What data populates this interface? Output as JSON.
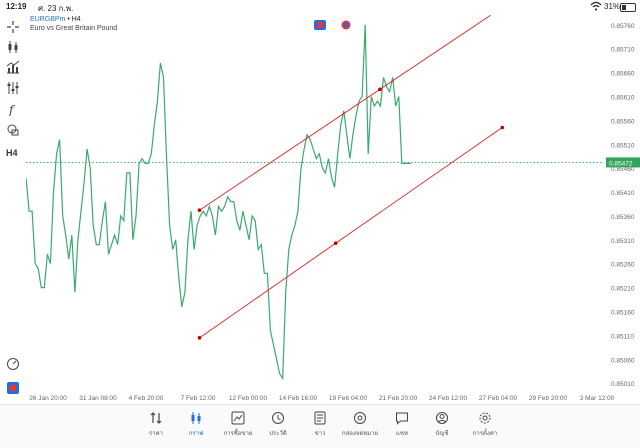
{
  "status": {
    "time": "12:19",
    "date": "ศ. 23 ก.พ.",
    "battery": "31%",
    "battery_level": 0.31
  },
  "symbol": {
    "name": "EURGBPm",
    "timeframe": "H4",
    "separator": " • ",
    "description": "Euro vs Great Britain Pound"
  },
  "left_toolbar": {
    "h4_label": "H4"
  },
  "colors": {
    "line": "#3aaa6e",
    "trendline": "#e02020",
    "price_tag": "#2fa65c",
    "accent": "#1e6fd9",
    "grid_text": "#666666"
  },
  "chart_data": {
    "type": "line",
    "y_ticks": [
      "0.85760",
      "0.85710",
      "0.85660",
      "0.85610",
      "0.85560",
      "0.85510",
      "0.85460",
      "0.85410",
      "0.85360",
      "0.85310",
      "0.85260",
      "0.85210",
      "0.85160",
      "0.85110",
      "0.85060",
      "0.85010"
    ],
    "ylim": [
      0.85,
      0.8577
    ],
    "x_ticks": [
      "26 Jan 20:00",
      "31 Jan 08:00",
      "4 Feb 20:00",
      "7 Feb 12:00",
      "12 Feb 00:00",
      "14 Feb 16:00",
      "19 Feb 04:00",
      "21 Feb 20:00",
      "24 Feb 12:00",
      "27 Feb 04:00",
      "29 Feb 20:00",
      "3 Mar 12:00"
    ],
    "current_price": "0.85472",
    "series_values": [
      0.8544,
      0.8537,
      0.8537,
      0.8526,
      0.8525,
      0.8521,
      0.8521,
      0.8528,
      0.8526,
      0.8541,
      0.8549,
      0.8552,
      0.8536,
      0.8532,
      0.8527,
      0.8532,
      0.852,
      0.8531,
      0.8537,
      0.8543,
      0.855,
      0.8546,
      0.8534,
      0.853,
      0.853,
      0.8535,
      0.8539,
      0.8528,
      0.853,
      0.8532,
      0.853,
      0.8536,
      0.8535,
      0.8545,
      0.8545,
      0.8531,
      0.8536,
      0.8547,
      0.8548,
      0.8547,
      0.8547,
      0.8549,
      0.8555,
      0.856,
      0.8568,
      0.8565,
      0.8548,
      0.8534,
      0.8529,
      0.8531,
      0.8523,
      0.8517,
      0.852,
      0.8531,
      0.8537,
      0.8529,
      0.8534,
      0.8536,
      0.8537,
      0.8536,
      0.8538,
      0.8536,
      0.8532,
      0.8538,
      0.8537,
      0.8538,
      0.854,
      0.8539,
      0.8539,
      0.8535,
      0.8533,
      0.8537,
      0.8534,
      0.8531,
      0.8536,
      0.8535,
      0.8529,
      0.853,
      0.8524,
      0.8524,
      0.8512,
      0.8509,
      0.8506,
      0.8503,
      0.8502,
      0.852,
      0.8529,
      0.8532,
      0.8534,
      0.8537,
      0.8546,
      0.855,
      0.8553,
      0.8552,
      0.855,
      0.8548,
      0.8549,
      0.8546,
      0.8545,
      0.8548,
      0.8544,
      0.8542,
      0.8549,
      0.8555,
      0.8558,
      0.8553,
      0.8548,
      0.8553,
      0.8557,
      0.856,
      0.8561,
      0.8576,
      0.8549,
      0.8561,
      0.8559,
      0.856,
      0.8559,
      0.8565,
      0.8563,
      0.8562,
      0.8565,
      0.8559,
      0.8561,
      0.8547,
      0.8547,
      0.8547,
      0.8547
    ],
    "trendlines": [
      {
        "x_from": 0.295,
        "y_from": 0.85372,
        "x_to": 0.79,
        "y_to": 0.8578
      },
      {
        "x_from": 0.295,
        "y_from": 0.85105,
        "x_to": 0.81,
        "y_to": 0.85545
      }
    ]
  },
  "nav": [
    {
      "key": "quotes",
      "label": "ราคา",
      "icon": "quotes-icon"
    },
    {
      "key": "chart",
      "label": "กราฟ",
      "icon": "chart-icon",
      "active": true
    },
    {
      "key": "trade",
      "label": "การซื้อขาย",
      "icon": "trade-icon"
    },
    {
      "key": "history",
      "label": "ประวัติ",
      "icon": "history-icon"
    },
    {
      "key": "news",
      "label": "ข่าว",
      "icon": "news-icon"
    },
    {
      "key": "mailbox",
      "label": "กล่องจดหมาย",
      "icon": "mail-icon"
    },
    {
      "key": "chat",
      "label": "แชท",
      "icon": "chat-icon"
    },
    {
      "key": "accounts",
      "label": "บัญชี",
      "icon": "account-icon"
    },
    {
      "key": "settings",
      "label": "การตั้งค่า",
      "icon": "settings-icon"
    }
  ]
}
